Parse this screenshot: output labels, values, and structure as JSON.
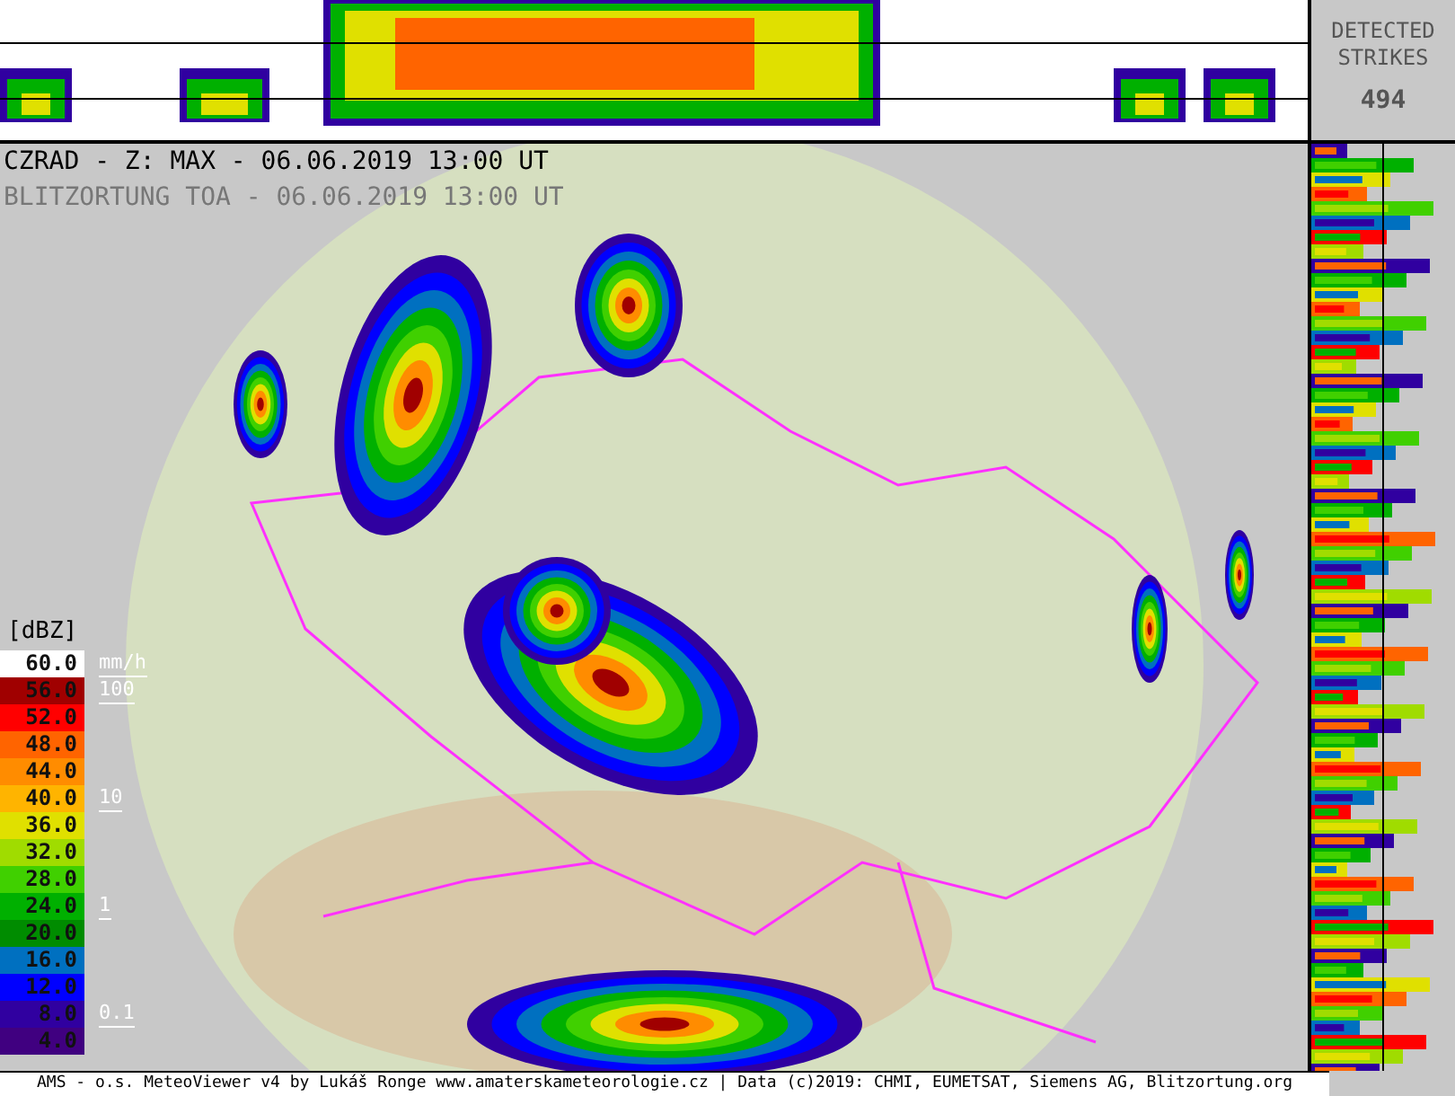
{
  "titles": [
    {
      "kind": "main",
      "text": "CZRAD - Z: MAX - 06.06.2019 13:00 UT"
    },
    {
      "kind": "sub",
      "text": "BLITZORTUNG TOA - 06.06.2019 13:00 UT"
    }
  ],
  "strikes": {
    "label_1": "DETECTED",
    "label_2": "STRIKES",
    "count": "494"
  },
  "legend": {
    "unit": "[dBZ]",
    "entries": [
      {
        "value": "60.0",
        "color": "#ffffff",
        "rain": "mm/h"
      },
      {
        "value": "56.0",
        "color": "#a00000",
        "rain": "100"
      },
      {
        "value": "52.0",
        "color": "#ff0000"
      },
      {
        "value": "48.0",
        "color": "#ff6400"
      },
      {
        "value": "44.0",
        "color": "#ff8c00"
      },
      {
        "value": "40.0",
        "color": "#ffb400",
        "rain": "10"
      },
      {
        "value": "36.0",
        "color": "#e0e000"
      },
      {
        "value": "32.0",
        "color": "#a0dc00"
      },
      {
        "value": "28.0",
        "color": "#40d000"
      },
      {
        "value": "24.0",
        "color": "#00b000",
        "rain": "1"
      },
      {
        "value": "20.0",
        "color": "#008c00"
      },
      {
        "value": "16.0",
        "color": "#0070c0"
      },
      {
        "value": "12.0",
        "color": "#0000ff"
      },
      {
        "value": "8.0",
        "color": "#3000a0",
        "rain": "0.1"
      },
      {
        "value": "4.0",
        "color": "#400080"
      }
    ]
  },
  "status_bar": "AMS - o.s. MeteoViewer v4 by Lukáš Ronge www.amaterskameteorologie.cz | Data (c)2019: CHMI, EUMETSAT, Siemens AG, Blitzortung.org"
}
